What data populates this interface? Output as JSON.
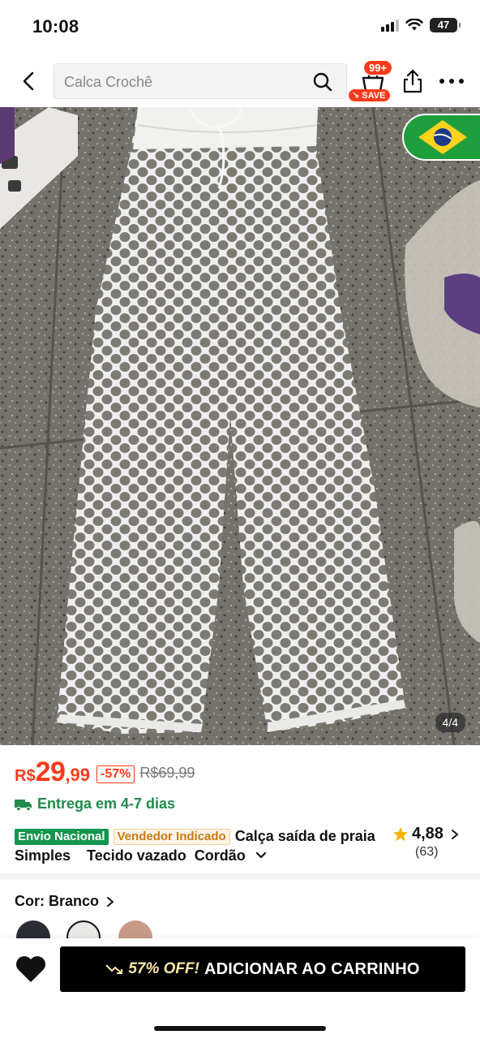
{
  "status_bar": {
    "time": "10:08",
    "battery": "47"
  },
  "nav": {
    "search_text": "Calca Crochê",
    "cart_count": "99+",
    "save_label": "SAVE"
  },
  "gallery": {
    "counter": "4/4",
    "flag": "brazil-flag"
  },
  "price": {
    "currency": "R$",
    "integer": "29",
    "decimal": ",99",
    "discount": "-57%",
    "original": "R$69,99"
  },
  "delivery": {
    "text": "Entrega em 4-7 dias"
  },
  "product": {
    "tag_national": "Envio Nacional",
    "tag_seller": "Vendedor Indicado",
    "title": "Calça saída de praia  Simples    Tecido vazado  Cordão"
  },
  "rating": {
    "value": "4,88",
    "count": "(63)"
  },
  "color": {
    "label": "Cor: Branco"
  },
  "bottom": {
    "promo": "57% OFF!",
    "cta": "ADICIONAR AO CARRINHO"
  },
  "colors": {
    "accent": "#fa3b1b",
    "green": "#14964c",
    "delivery": "#1f8a4c"
  }
}
